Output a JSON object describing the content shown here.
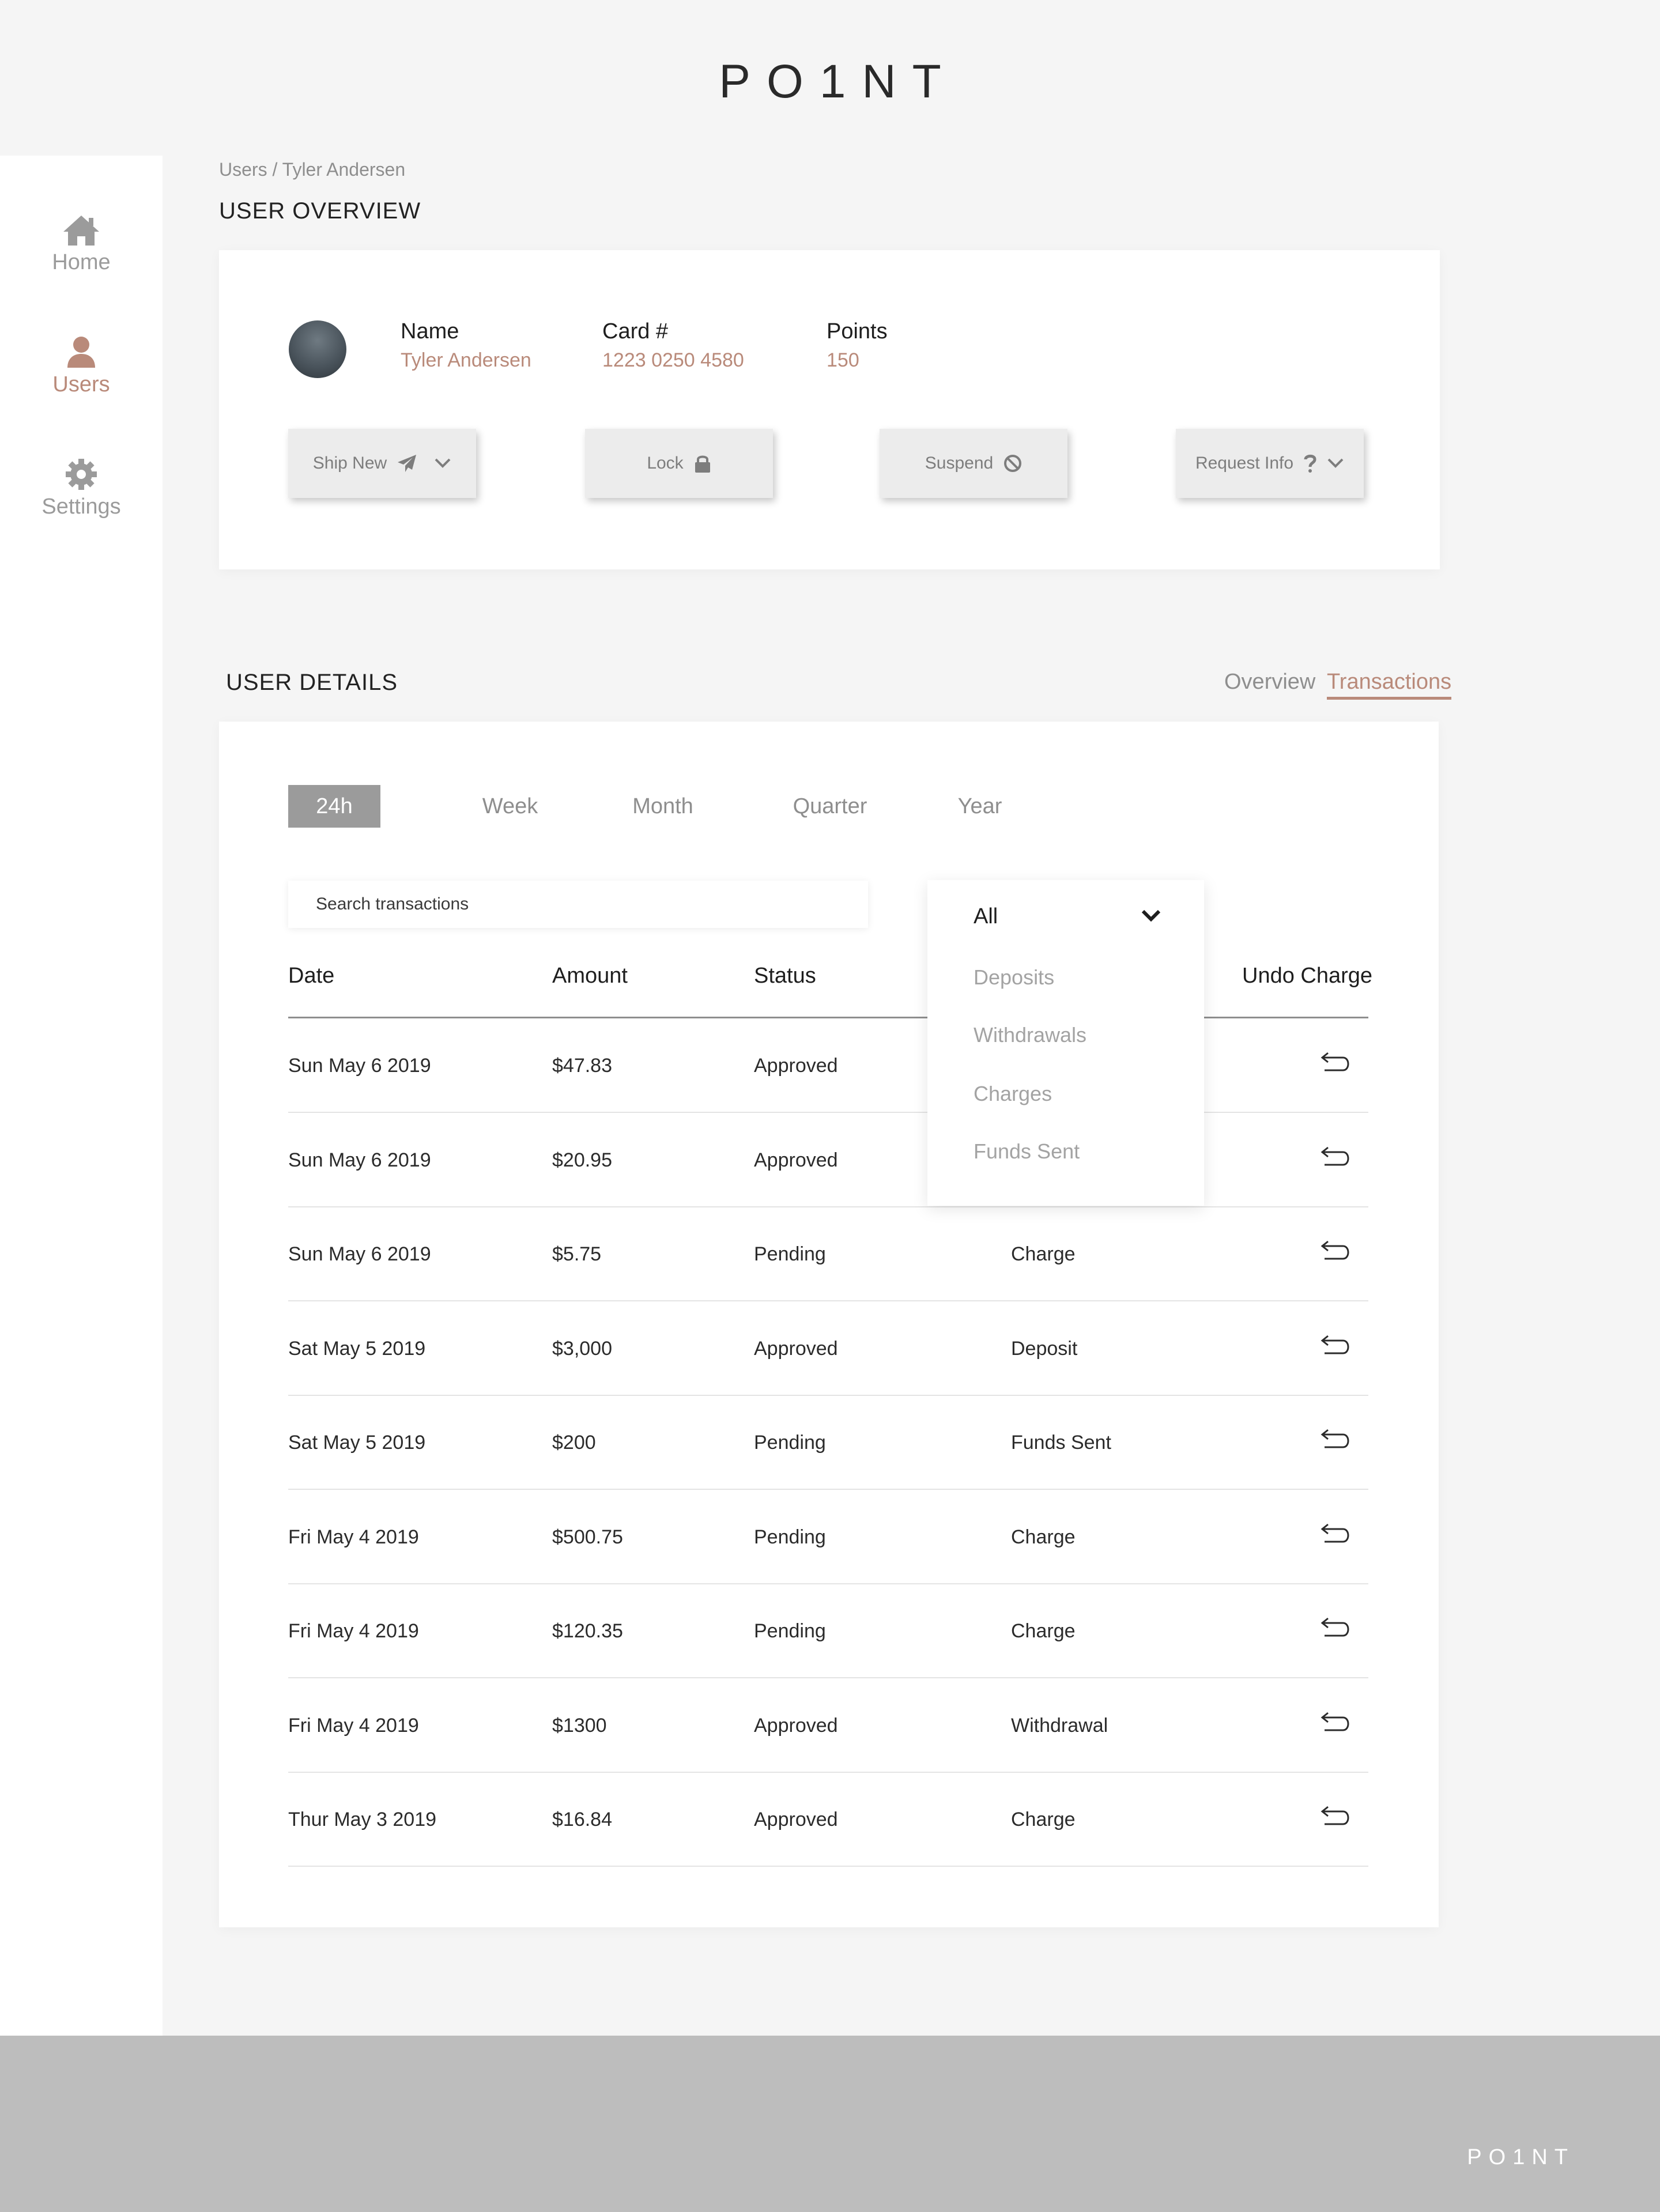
{
  "header": {
    "logo": "PO1NT"
  },
  "sidebar": {
    "items": [
      {
        "label": "Home",
        "icon": "home-icon",
        "active": false
      },
      {
        "label": "Users",
        "icon": "user-icon",
        "active": true
      },
      {
        "label": "Settings",
        "icon": "gear-icon",
        "active": false
      }
    ]
  },
  "breadcrumb": "Users / Tyler Andersen",
  "overview": {
    "title": "USER OVERVIEW",
    "name_label": "Name",
    "name_value": "Tyler Andersen",
    "card_label": "Card #",
    "card_value": "1223 0250 4580",
    "points_label": "Points",
    "points_value": "150",
    "actions": {
      "ship_new": "Ship New",
      "lock": "Lock",
      "suspend": "Suspend",
      "request_info": "Request Info"
    }
  },
  "details": {
    "title": "USER DETAILS",
    "tabs": [
      {
        "label": "Overview",
        "active": false
      },
      {
        "label": "Transactions",
        "active": true
      }
    ],
    "periods": [
      "24h",
      "Week",
      "Month",
      "Quarter",
      "Year"
    ],
    "active_period": "24h",
    "search": {
      "placeholder": "Search transactions",
      "value": ""
    },
    "filter": {
      "selected": "All",
      "options": [
        "Deposits",
        "Withdrawals",
        "Charges",
        "Funds Sent"
      ]
    },
    "columns": {
      "date": "Date",
      "amount": "Amount",
      "status": "Status",
      "undo": "Undo Charge"
    },
    "rows": [
      {
        "date": "Sun May 6 2019",
        "amount": "$47.83",
        "status": "Approved",
        "type": ""
      },
      {
        "date": "Sun May 6 2019",
        "amount": "$20.95",
        "status": "Approved",
        "type": ""
      },
      {
        "date": "Sun May 6 2019",
        "amount": "$5.75",
        "status": "Pending",
        "type": "Charge"
      },
      {
        "date": "Sat May 5 2019",
        "amount": "$3,000",
        "status": "Approved",
        "type": "Deposit"
      },
      {
        "date": "Sat May 5 2019",
        "amount": "$200",
        "status": "Pending",
        "type": "Funds Sent"
      },
      {
        "date": "Fri May 4 2019",
        "amount": "$500.75",
        "status": "Pending",
        "type": "Charge"
      },
      {
        "date": "Fri May 4 2019",
        "amount": "$120.35",
        "status": "Pending",
        "type": "Charge"
      },
      {
        "date": "Fri May 4 2019",
        "amount": "$1300",
        "status": "Approved",
        "type": "Withdrawal"
      },
      {
        "date": "Thur May 3 2019",
        "amount": "$16.84",
        "status": "Approved",
        "type": "Charge"
      }
    ]
  },
  "footer": {
    "logo": "PO1NT"
  },
  "colors": {
    "accent": "#b98a7a",
    "page_bg": "#f5f5f5",
    "footer_bg": "#bdbdbd",
    "active_period_bg": "#9b9b9b"
  }
}
